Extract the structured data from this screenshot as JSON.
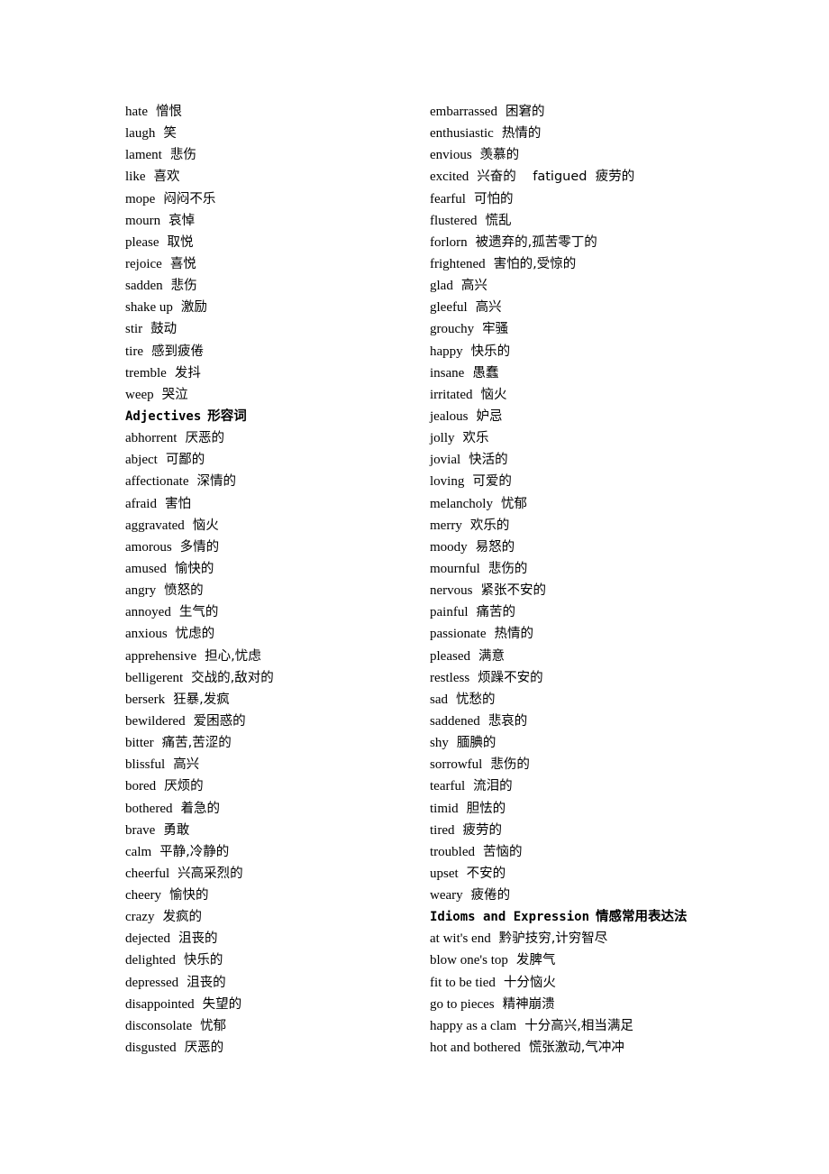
{
  "columns": [
    [
      {
        "en": "hate",
        "zh": "憎恨"
      },
      {
        "en": "laugh",
        "zh": "笑"
      },
      {
        "en": "lament",
        "zh": "悲伤"
      },
      {
        "en": "like",
        "zh": "喜欢"
      },
      {
        "en": "mope",
        "zh": "闷闷不乐"
      },
      {
        "en": "mourn",
        "zh": "哀悼"
      },
      {
        "en": "please",
        "zh": "取悦"
      },
      {
        "en": "rejoice",
        "zh": "喜悦"
      },
      {
        "en": "sadden",
        "zh": "悲伤"
      },
      {
        "en": "shake up",
        "zh": "激励"
      },
      {
        "en": "stir",
        "zh": "鼓动"
      },
      {
        "en": "tire",
        "zh": "感到疲倦"
      },
      {
        "en": "tremble",
        "zh": "发抖"
      },
      {
        "en": "weep",
        "zh": "哭泣"
      },
      {
        "heading": true,
        "en": "Adjectives",
        "zh": "形容词"
      },
      {
        "en": "abhorrent",
        "zh": "厌恶的"
      },
      {
        "en": "abject",
        "zh": "可鄙的"
      },
      {
        "en": "affectionate",
        "zh": "深情的"
      },
      {
        "en": "afraid",
        "zh": "害怕"
      },
      {
        "en": "aggravated",
        "zh": "恼火"
      },
      {
        "en": "amorous",
        "zh": "多情的"
      },
      {
        "en": "amused",
        "zh": "愉快的"
      },
      {
        "en": "angry",
        "zh": "愤怒的"
      },
      {
        "en": "annoyed",
        "zh": "生气的"
      },
      {
        "en": "anxious",
        "zh": "忧虑的"
      },
      {
        "en": "apprehensive",
        "zh": "担心,忧虑"
      },
      {
        "en": "belligerent",
        "zh": "交战的,敌对的"
      },
      {
        "en": "berserk",
        "zh": "狂暴,发疯"
      },
      {
        "en": "bewildered",
        "zh": "爱困惑的"
      },
      {
        "en": "bitter",
        "zh": "痛苦,苦涩的"
      },
      {
        "en": "blissful",
        "zh": "高兴"
      },
      {
        "en": "bored",
        "zh": "厌烦的"
      },
      {
        "en": "bothered",
        "zh": "着急的"
      },
      {
        "en": "brave",
        "zh": "勇敢"
      },
      {
        "en": "calm",
        "zh": "平静,冷静的"
      },
      {
        "en": "cheerful",
        "zh": "兴高采烈的"
      },
      {
        "en": "cheery",
        "zh": "愉快的"
      },
      {
        "en": "crazy",
        "zh": "发疯的"
      },
      {
        "en": "dejected",
        "zh": "沮丧的"
      },
      {
        "en": "delighted",
        "zh": "快乐的"
      },
      {
        "en": "depressed",
        "zh": "沮丧的"
      },
      {
        "en": "disappointed",
        "zh": "失望的"
      },
      {
        "en": "disconsolate",
        "zh": "忧郁"
      },
      {
        "en": "disgusted",
        "zh": "厌恶的"
      }
    ],
    [
      {
        "en": "embarrassed",
        "zh": "困窘的"
      },
      {
        "en": "enthusiastic",
        "zh": "热情的"
      },
      {
        "en": "envious",
        "zh": "羡慕的"
      },
      {
        "en": "excited",
        "zh": "兴奋的    fatigued  疲劳的"
      },
      {
        "en": "fearful",
        "zh": "可怕的"
      },
      {
        "en": "flustered",
        "zh": "慌乱"
      },
      {
        "en": "forlorn",
        "zh": "被遗弃的,孤苦零丁的"
      },
      {
        "en": "frightened",
        "zh": "害怕的,受惊的"
      },
      {
        "en": "glad",
        "zh": "高兴"
      },
      {
        "en": "gleeful",
        "zh": "高兴"
      },
      {
        "en": "grouchy",
        "zh": "牢骚"
      },
      {
        "en": "happy",
        "zh": "快乐的"
      },
      {
        "en": "insane",
        "zh": "愚蠢"
      },
      {
        "en": "irritated",
        "zh": "恼火"
      },
      {
        "en": "jealous",
        "zh": "妒忌"
      },
      {
        "en": "jolly",
        "zh": "欢乐"
      },
      {
        "en": "jovial",
        "zh": "快活的"
      },
      {
        "en": "loving",
        "zh": "可爱的"
      },
      {
        "en": "melancholy",
        "zh": "忧郁"
      },
      {
        "en": "merry",
        "zh": "欢乐的"
      },
      {
        "en": "moody",
        "zh": "易怒的"
      },
      {
        "en": "mournful",
        "zh": "悲伤的"
      },
      {
        "en": "nervous",
        "zh": "紧张不安的"
      },
      {
        "en": "painful",
        "zh": "痛苦的"
      },
      {
        "en": "passionate",
        "zh": "热情的"
      },
      {
        "en": "pleased",
        "zh": "满意"
      },
      {
        "en": "restless",
        "zh": "烦躁不安的"
      },
      {
        "en": "sad",
        "zh": "忧愁的"
      },
      {
        "en": "saddened",
        "zh": "悲哀的"
      },
      {
        "en": "shy",
        "zh": "腼腆的"
      },
      {
        "en": "sorrowful",
        "zh": "悲伤的"
      },
      {
        "en": "tearful",
        "zh": "流泪的"
      },
      {
        "en": "timid",
        "zh": "胆怯的"
      },
      {
        "en": "tired",
        "zh": "疲劳的"
      },
      {
        "en": "troubled",
        "zh": "苦恼的"
      },
      {
        "en": "upset",
        "zh": "不安的"
      },
      {
        "en": "weary",
        "zh": "疲倦的"
      },
      {
        "heading": true,
        "en": "Idioms and Expression",
        "zh": "情感常用表达法"
      },
      {
        "en": "at wit's end",
        "zh": "黔驴技穷,计穷智尽"
      },
      {
        "en": "blow one's top",
        "zh": "发脾气"
      },
      {
        "en": "fit to be tied",
        "zh": "十分恼火"
      },
      {
        "en": "go to pieces",
        "zh": "精神崩溃"
      },
      {
        "en": "happy as a clam",
        "zh": "十分高兴,相当满足"
      },
      {
        "en": "hot and bothered",
        "zh": "慌张激动,气冲冲"
      }
    ]
  ]
}
